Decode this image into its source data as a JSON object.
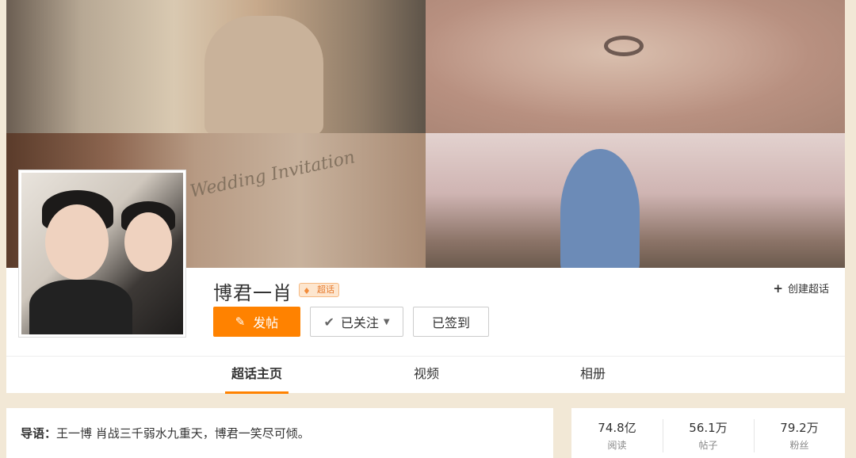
{
  "banner": {
    "invitation_text": "Wedding Invitation"
  },
  "profile": {
    "title": "博君一肖",
    "badge": "超话",
    "create_label": "创建超话",
    "post_label": "发帖",
    "follow_label": "已关注",
    "checkin_label": "已签到"
  },
  "tabs": [
    {
      "label": "超话主页",
      "active": true
    },
    {
      "label": "视频",
      "active": false
    },
    {
      "label": "相册",
      "active": false
    }
  ],
  "intro": {
    "prefix": "导语：",
    "text": "王一博 肖战三千弱水九重天，博君一笑尽可倾。"
  },
  "stats": [
    {
      "value": "74.8亿",
      "label": "阅读"
    },
    {
      "value": "56.1万",
      "label": "帖子"
    },
    {
      "value": "79.2万",
      "label": "粉丝"
    }
  ],
  "colors": {
    "accent": "#ff8200",
    "page_bg": "#f2e8d6"
  }
}
